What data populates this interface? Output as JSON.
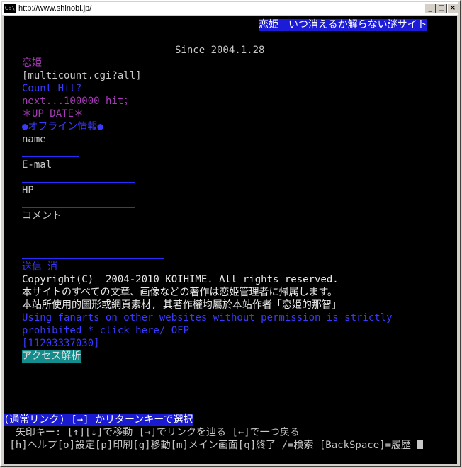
{
  "window": {
    "title": "http://www.shinobi.jp/",
    "icon_label": "C:\\",
    "controls": {
      "minimize": "_",
      "maximize": "□",
      "close": "×"
    }
  },
  "page": {
    "header_title": "恋姫　いつ消えるか解らない謎サイト",
    "since": "Since 2004.1.28",
    "site_name": "恋姫",
    "counter": "[multicount.cgi?all]",
    "count_hit": "Count Hit?",
    "next_hit": "next...100000 hit；",
    "update": "＊UP DATE＊",
    "offline_info": "●オフライン情報●",
    "form": {
      "name_label": "name",
      "email_label": "E-mal",
      "hp_label": "HP",
      "comment_label": "コメント",
      "submit": "送信",
      "clear": "消"
    },
    "copyright": "Copyright(C)  2004-2010 KOIHIME. All rights reserved.",
    "notice_ja": "本サイトのすべての文章、画像などの著作は恋姫管理者に帰属します。",
    "notice_zh": "本站所使用的圖形或網頁素材, 其著作權均屬於本站作者「恋姫的那智」",
    "fanart_line1": "Using fanarts on other websites without permission is strictly",
    "fanart_line2": "prohibited * click here/ OFP",
    "code": "[11203337030]",
    "access": "アクセス解析"
  },
  "status": {
    "link_hint": "(通常リンク) [→] かリターンキーで選択",
    "arrow_help": "  矢印キー: [↑][↓]で移動 [→]でリンクを辿る [←]で一つ戻る",
    "command_help": " [h]ヘルプ[o]設定[p]印刷[g]移動[m]メイン画面[q]終了 /=検索 [BackSpace]=履歴"
  },
  "colors": {
    "background": "#000000",
    "text": "#c8c8c8",
    "link": "#3a3aff",
    "visited": "#a63cb8",
    "highlight": "#1b1bd8",
    "teal": "#148c8c"
  }
}
